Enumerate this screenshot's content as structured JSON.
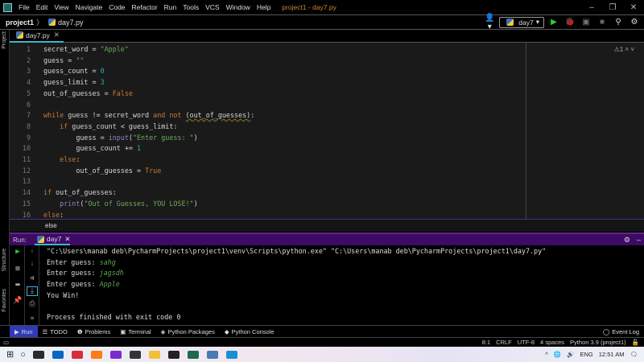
{
  "titlebar": {
    "menu": [
      "File",
      "Edit",
      "View",
      "Navigate",
      "Code",
      "Refactor",
      "Run",
      "Tools",
      "VCS",
      "Window",
      "Help"
    ],
    "title": "project1 - day7.py"
  },
  "navbar": {
    "project": "project1",
    "file": "day7.py",
    "run_config": "day7"
  },
  "tabs": [
    {
      "label": "day7.py"
    }
  ],
  "sidebar": {
    "project": "Project",
    "structure": "Structure",
    "favorites": "Favorites"
  },
  "editor": {
    "warnings": "1",
    "lines": [
      [
        [
          "secret_word = ",
          ""
        ],
        [
          "\"Apple\"",
          "st"
        ]
      ],
      [
        [
          "guess = ",
          ""
        ],
        [
          "\"\"",
          "st"
        ]
      ],
      [
        [
          "guess_count = ",
          ""
        ],
        [
          "0",
          "nu"
        ]
      ],
      [
        [
          "guess_limit = ",
          ""
        ],
        [
          "3",
          "nu"
        ]
      ],
      [
        [
          "out_of_guesses = ",
          ""
        ],
        [
          "False",
          "kw"
        ]
      ],
      [],
      [
        [
          "while",
          "kw"
        ],
        [
          " guess != secret_word ",
          ""
        ],
        [
          "and not",
          "kw"
        ],
        [
          " ",
          ""
        ],
        [
          "(out_of_guesses)",
          "ul"
        ],
        [
          ":",
          ""
        ]
      ],
      [
        [
          "    ",
          ""
        ],
        [
          "if",
          "kw"
        ],
        [
          " guess_count < guess_limit:",
          ""
        ]
      ],
      [
        [
          "        guess = ",
          ""
        ],
        [
          "input",
          "bi"
        ],
        [
          "(",
          ""
        ],
        [
          "\"Enter guess: \"",
          "st"
        ],
        [
          ")",
          ""
        ]
      ],
      [
        [
          "        guess_count += ",
          ""
        ],
        [
          "1",
          "nu"
        ]
      ],
      [
        [
          "    ",
          ""
        ],
        [
          "else",
          "kw"
        ],
        [
          ":",
          ""
        ]
      ],
      [
        [
          "        out_of_guesses = ",
          ""
        ],
        [
          "True",
          "kw"
        ]
      ],
      [],
      [
        [
          "if",
          "kw"
        ],
        [
          " out_of_guesses:",
          ""
        ]
      ],
      [
        [
          "    ",
          ""
        ],
        [
          "print",
          "bi"
        ],
        [
          "(",
          ""
        ],
        [
          "\"Out of Guesses, YOU LOSE!\"",
          "st"
        ],
        [
          ")",
          ""
        ]
      ],
      [
        [
          "else",
          "kw"
        ],
        [
          ":",
          ""
        ]
      ]
    ]
  },
  "breadcrumb": "else",
  "run": {
    "label": "Run:",
    "tab": "day7",
    "output": [
      [
        [
          "\"C:\\Users\\manab deb\\PycharmProjects\\project1\\venv\\Scripts\\python.exe\" \"C:\\Users\\manab deb\\PycharmProjects\\project1\\day7.py\"",
          ""
        ]
      ],
      [
        [
          "Enter guess: ",
          ""
        ],
        [
          "sahg",
          "inp"
        ]
      ],
      [
        [
          "Enter guess: ",
          ""
        ],
        [
          "jagsdh",
          "inp"
        ]
      ],
      [
        [
          "Enter guess: ",
          ""
        ],
        [
          "Apple",
          "inp"
        ]
      ],
      [
        [
          "You Win!",
          ""
        ]
      ],
      [],
      [
        [
          "Process finished with exit code 0",
          ""
        ]
      ]
    ]
  },
  "bottom_tabs": [
    "Run",
    "TODO",
    "Problems",
    "Terminal",
    "Python Packages",
    "Python Console"
  ],
  "event_log": "Event Log",
  "status": {
    "position": "8:1",
    "line_sep": "CRLF",
    "encoding": "UTF-8",
    "indent": "4 spaces",
    "interpreter": "Python 3.9 (project1)"
  },
  "taskbar": {
    "lang": "ENG",
    "time": "12:51 AM",
    "apps": [
      "#2b2b2b",
      "#0a66c2",
      "#d92c3c",
      "#ff7a18",
      "#7a2bd0",
      "#333",
      "#f2c037",
      "#222",
      "#1d6b4f",
      "#4a7ab5",
      "#1b8fd6"
    ]
  }
}
